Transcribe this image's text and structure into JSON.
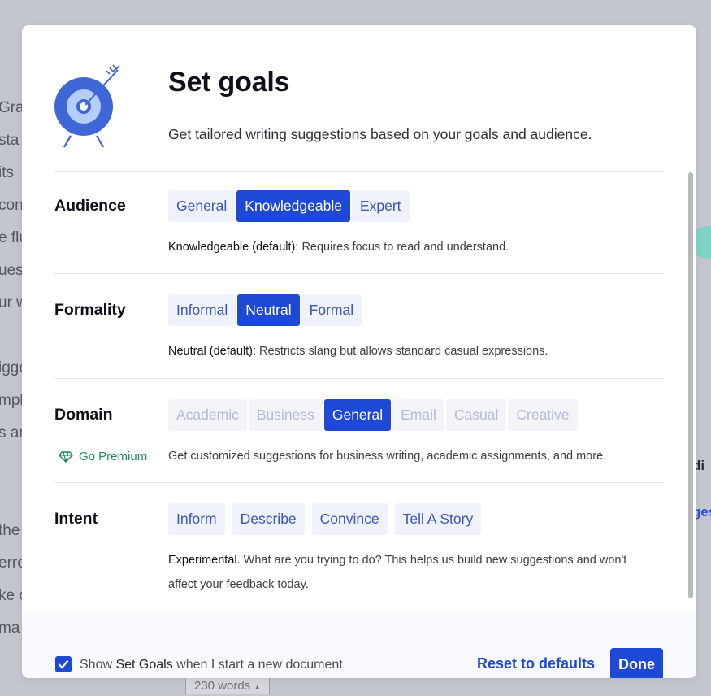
{
  "background": {
    "lines": [
      "Gra",
      "sta",
      "its",
      "con",
      "e flu",
      "ues",
      "ur w",
      "",
      "igge",
      "mpl",
      "s an",
      "",
      "",
      "the",
      "erro",
      "ke c",
      " ma"
    ],
    "right_label": "di",
    "right_link": "ges",
    "word_count": "230 words"
  },
  "modal": {
    "title": "Set goals",
    "subtitle": "Get tailored writing suggestions based on your goals and audience.",
    "accent_color": "#1e48d6"
  },
  "sections": {
    "audience": {
      "label": "Audience",
      "options": [
        "General",
        "Knowledgeable",
        "Expert"
      ],
      "selected": "Knowledgeable",
      "desc_strong": "Knowledgeable (default):",
      "desc": " Requires focus to read and understand."
    },
    "formality": {
      "label": "Formality",
      "options": [
        "Informal",
        "Neutral",
        "Formal"
      ],
      "selected": "Neutral",
      "desc_strong": "Neutral (default):",
      "desc": " Restricts slang but allows standard casual expressions."
    },
    "domain": {
      "label": "Domain",
      "options": [
        "Academic",
        "Business",
        "General",
        "Email",
        "Casual",
        "Creative"
      ],
      "selected": "General",
      "premium_label": "Go Premium",
      "desc": "Get customized suggestions for business writing, academic assignments, and more."
    },
    "intent": {
      "label": "Intent",
      "options": [
        "Inform",
        "Describe",
        "Convince",
        "Tell A Story"
      ],
      "desc_strong": "Experimental.",
      "desc": " What are you trying to do? This helps us build new suggestions and won't affect your feedback today."
    }
  },
  "footer": {
    "checkbox_checked": true,
    "show_prefix": "Show ",
    "show_emphasis": "Set Goals",
    "show_suffix": " when I start a new document",
    "reset_label": "Reset to defaults",
    "done_label": "Done"
  }
}
